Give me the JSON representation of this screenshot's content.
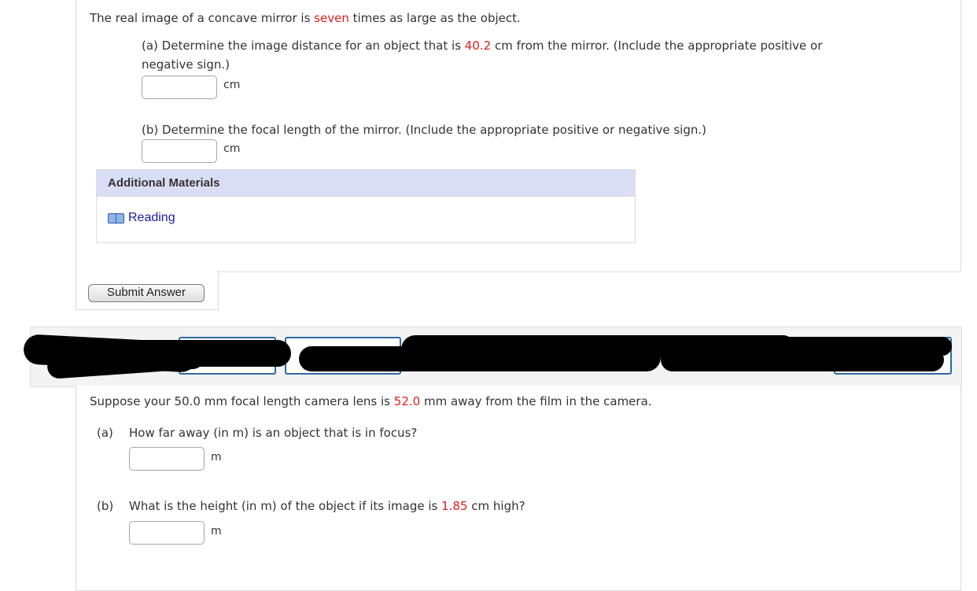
{
  "question1": {
    "intro_pre": "The real image of a concave mirror is ",
    "intro_highlight": "seven",
    "intro_post": " times as large as the object.",
    "part_a_line1_pre": "(a) Determine the image distance for an object that is ",
    "part_a_value": "40.2",
    "part_a_line1_post": " cm from the mirror. (Include the appropriate positive or",
    "part_a_line2": "negative sign.)",
    "part_a_unit": "cm",
    "part_a_input": "",
    "part_b_text": "(b) Determine the focal length of the mirror. (Include the appropriate positive or negative sign.)",
    "part_b_unit": "cm",
    "part_b_input": ""
  },
  "additional_materials": {
    "title": "Additional Materials",
    "link_label": "Reading",
    "link_icon": "book-icon"
  },
  "submit": {
    "label": "Submit Answer"
  },
  "question2": {
    "intro_pre": "Suppose your 50.0 mm focal length camera lens is ",
    "intro_highlight": "52.0",
    "intro_post": " mm away from the film in the camera.",
    "part_a_label": "(a)",
    "part_a_text": "How far away (in m) is an object that is in focus?",
    "part_a_unit": "m",
    "part_a_input": "",
    "part_b_label": "(b)",
    "part_b_text_pre": "What is the height (in m) of the object if its image is ",
    "part_b_value": "1.85",
    "part_b_text_post": " cm high?",
    "part_b_unit": "m",
    "part_b_input": ""
  },
  "colors": {
    "highlight": "#e0201c",
    "link": "#1a1aa6",
    "panel_header": "#d9def5",
    "nav_border": "#2d6aa6"
  }
}
